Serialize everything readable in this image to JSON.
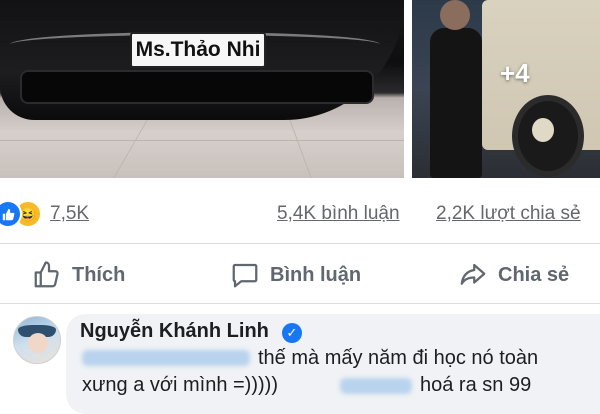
{
  "post": {
    "photos": {
      "main_plate_text": "Ms.Thảo Nhi",
      "more_photos_label": "+4"
    },
    "reactions": {
      "icons": [
        "like-icon",
        "haha-icon"
      ],
      "total": "7,5K",
      "comments": "5,4K bình luận",
      "shares": "2,2K lượt chia sẻ"
    },
    "actions": {
      "like": "Thích",
      "comment": "Bình luận",
      "share": "Chia sẻ"
    }
  },
  "comment": {
    "author": "Nguyễn Khánh Linh",
    "verified": true,
    "text_line1": "thế mà mấy năm đi học nó toàn",
    "text_line2a": "xưng a với mình =)))))",
    "text_line2b": "hoá ra sn 99"
  },
  "colors": {
    "accent": "#1877f2",
    "muted_text": "#65676b",
    "action_text": "#606770",
    "bubble_bg": "#f0f2f5"
  }
}
